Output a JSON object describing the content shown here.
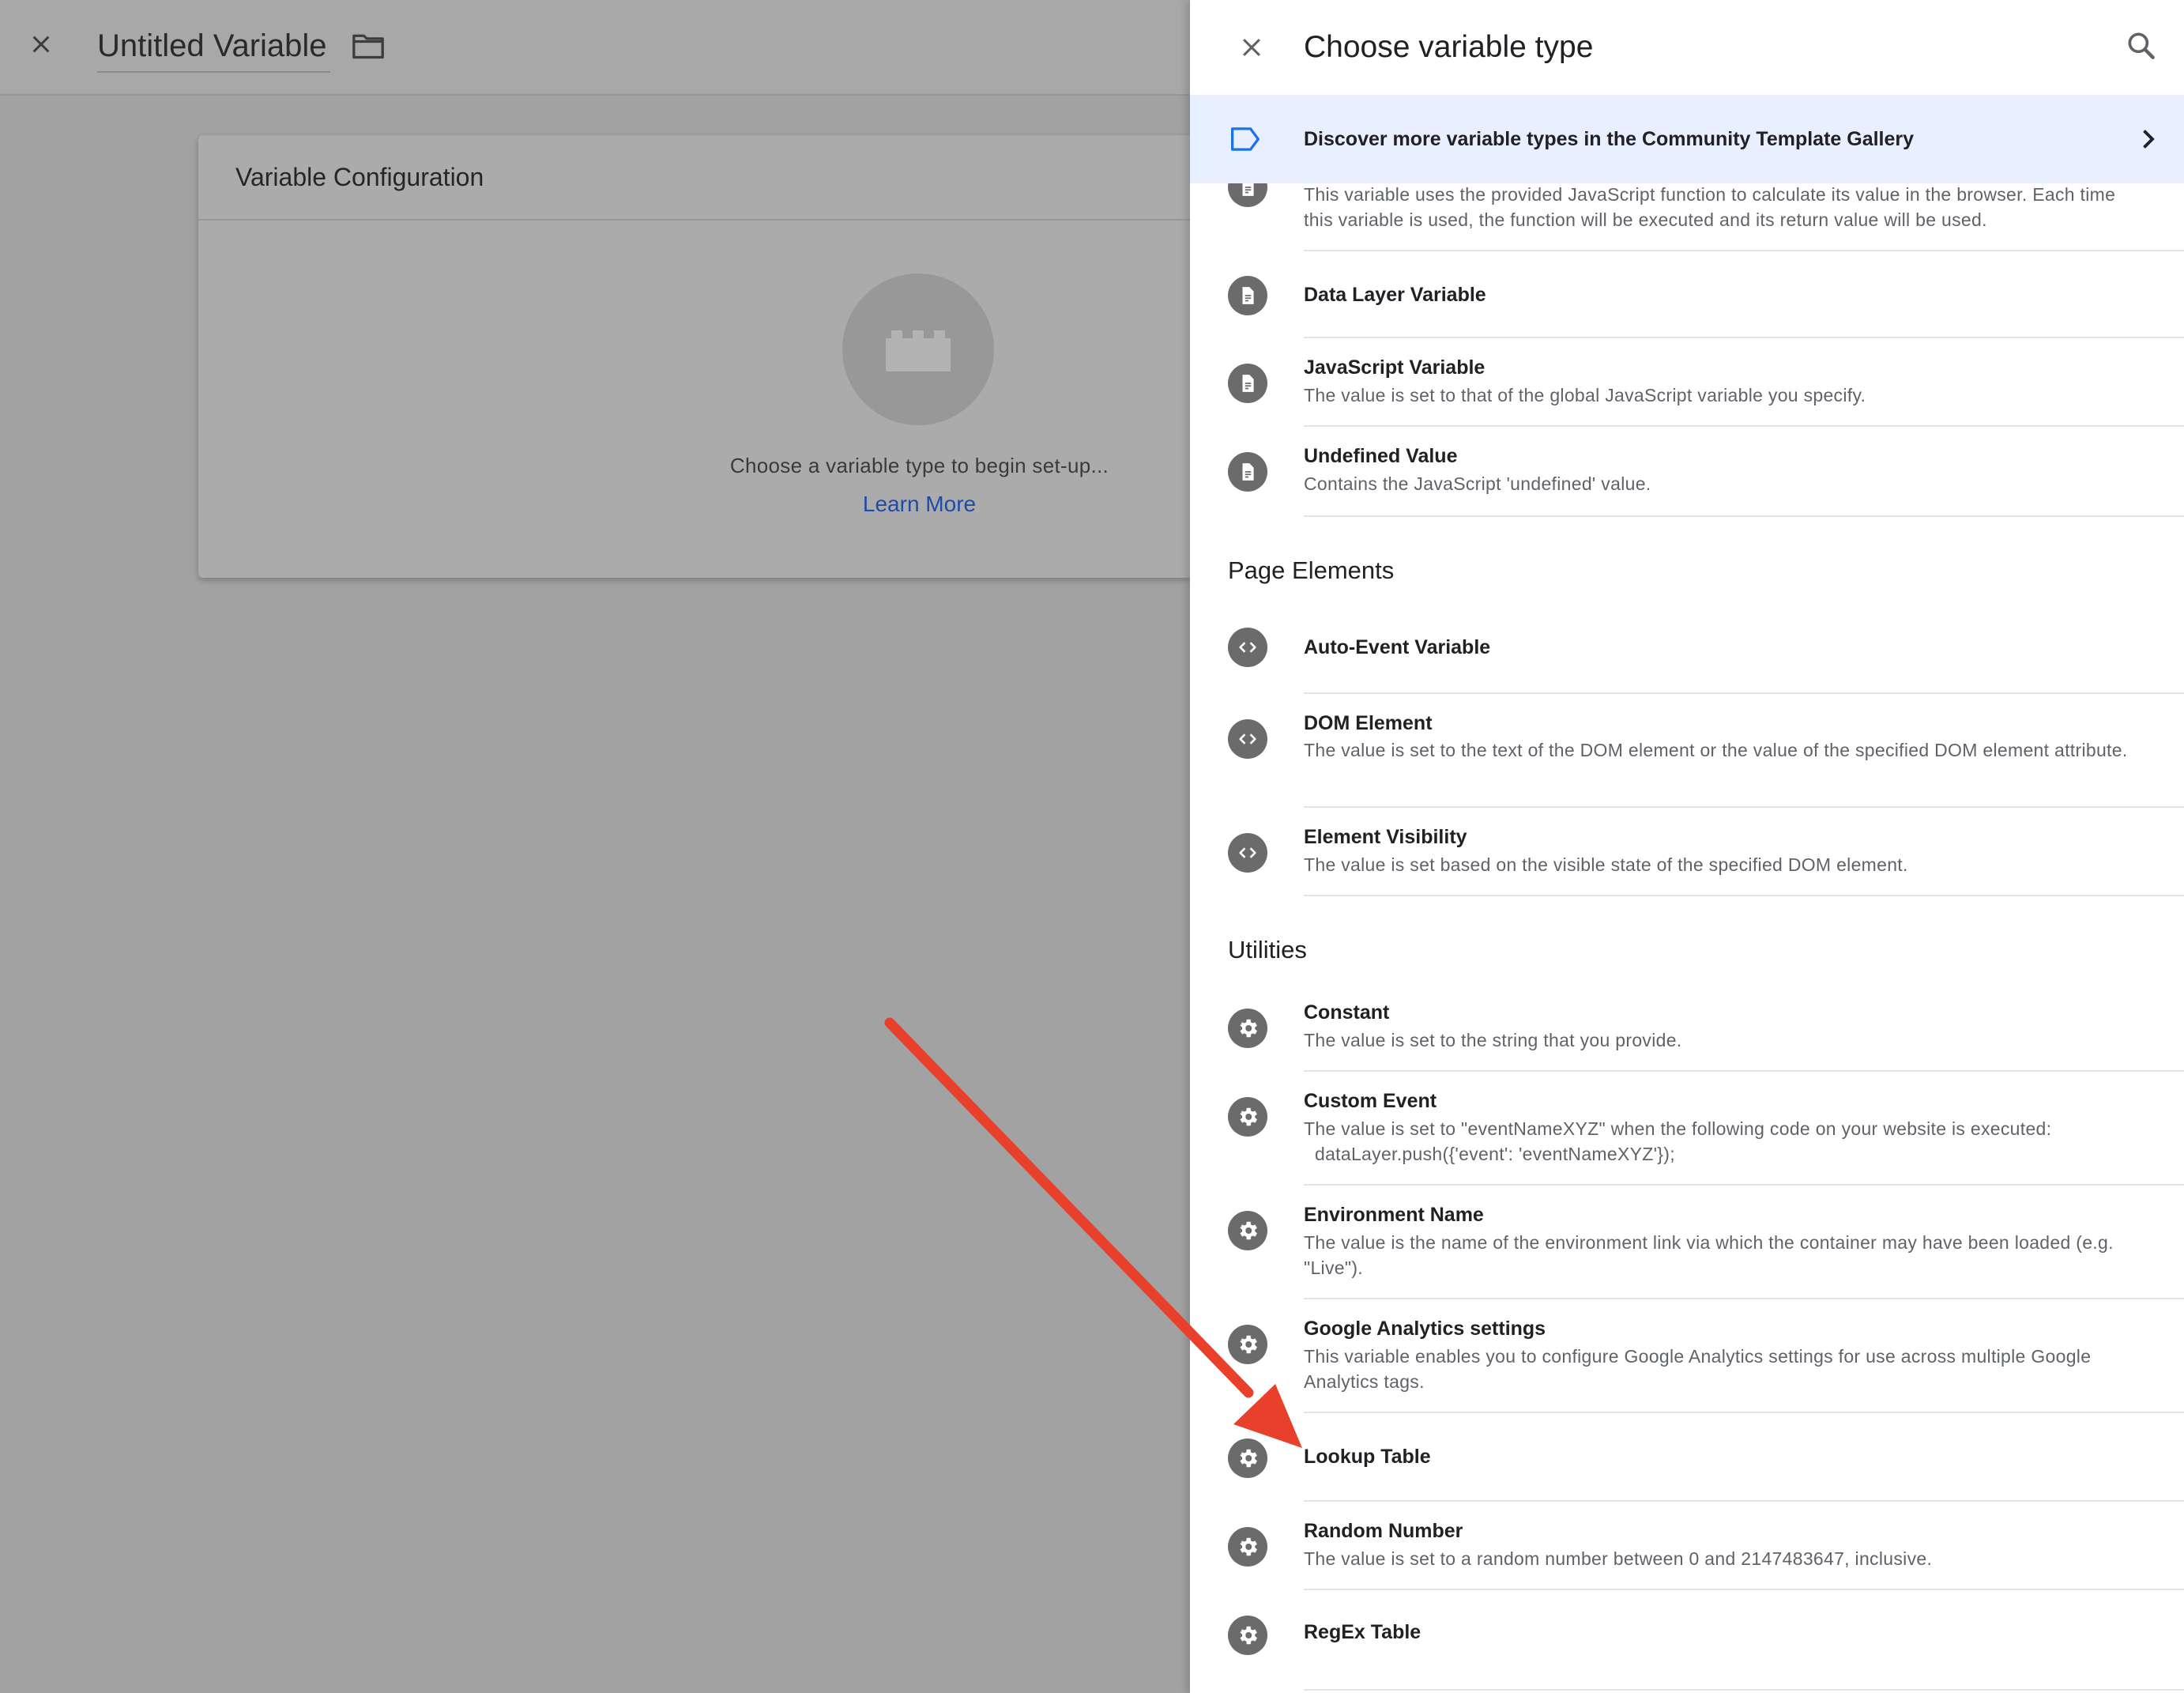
{
  "editor": {
    "variable_name": "Untitled Variable",
    "config_title": "Variable Configuration",
    "config_hint": "Choose a variable type to begin set-up...",
    "learn_more": "Learn More"
  },
  "panel": {
    "title": "Choose variable type",
    "gallery_banner": "Discover more variable types in the Community Template Gallery",
    "partial_item_desc": "This variable uses the provided JavaScript function to calculate its value in the browser. Each time this variable is used, the function will be executed and its return value will be used.",
    "items_top": [
      {
        "title": "Data Layer Variable",
        "desc": "",
        "icon": "document-icon"
      },
      {
        "title": "JavaScript Variable",
        "desc": "The value is set to that of the global JavaScript variable you specify.",
        "icon": "document-icon"
      },
      {
        "title": "Undefined Value",
        "desc": "Contains the JavaScript 'undefined' value.",
        "icon": "document-icon"
      }
    ],
    "section_page_elements": "Page Elements",
    "items_page_elements": [
      {
        "title": "Auto-Event Variable",
        "desc": "",
        "icon": "code-icon"
      },
      {
        "title": "DOM Element",
        "desc": "The value is set to the text of the DOM element or the value of the specified DOM element attribute.",
        "icon": "code-icon"
      },
      {
        "title": "Element Visibility",
        "desc": "The value is set based on the visible state of the specified DOM element.",
        "icon": "code-icon"
      }
    ],
    "section_utilities": "Utilities",
    "items_utilities": [
      {
        "title": "Constant",
        "desc": "The value is set to the string that you provide.",
        "icon": "gear-icon"
      },
      {
        "title": "Custom Event",
        "desc": "The value is set to \"eventNameXYZ\" when the following code on your website is executed:",
        "desc2": "dataLayer.push({'event': 'eventNameXYZ'});",
        "icon": "gear-icon"
      },
      {
        "title": "Environment Name",
        "desc": "The value is the name of the environment link via which the container may have been loaded (e.g. \"Live\").",
        "icon": "gear-icon"
      },
      {
        "title": "Google Analytics settings",
        "desc": "This variable enables you to configure Google Analytics settings for use across multiple Google Analytics tags.",
        "icon": "gear-icon"
      },
      {
        "title": "Lookup Table",
        "desc": "",
        "icon": "gear-icon"
      },
      {
        "title": "Random Number",
        "desc": "The value is set to a random number between 0 and 2147483647, inclusive.",
        "icon": "gear-icon"
      },
      {
        "title": "RegEx Table",
        "desc": "",
        "icon": "gear-icon"
      }
    ]
  },
  "colors": {
    "accent_blue": "#1a73e8",
    "banner_bg": "#e8efff",
    "annotation_arrow": "#e8402a",
    "icon_circle": "#6b6b6b"
  }
}
